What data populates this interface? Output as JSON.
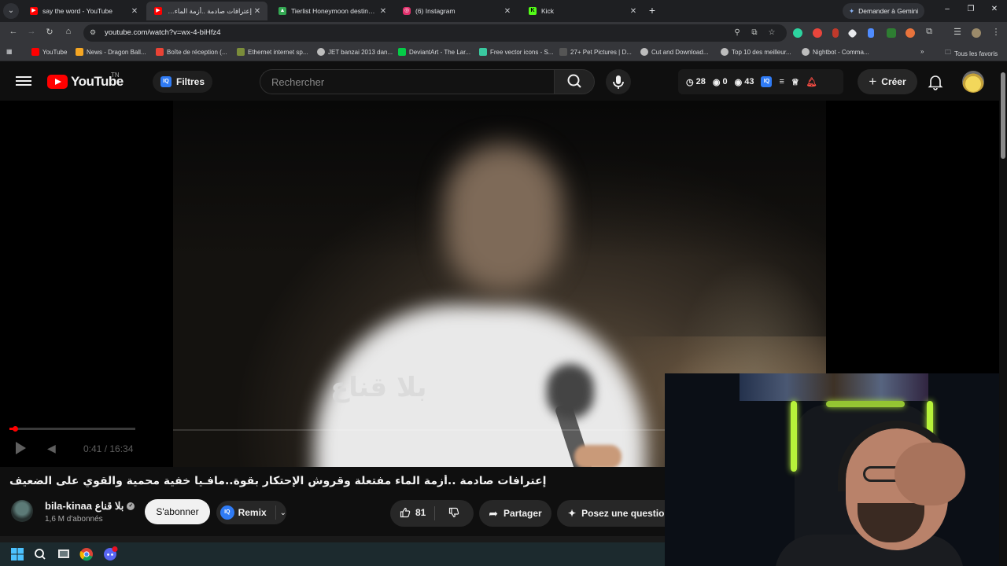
{
  "browser": {
    "tabs": [
      {
        "title": "say the word - YouTube",
        "favicon": "youtube-icon",
        "color": "#ff0000",
        "active": false
      },
      {
        "title": "إعترافات صادمة ..أزمة الماء مفت",
        "favicon": "youtube-icon",
        "color": "#ff0000",
        "active": true
      },
      {
        "title": "Tierlist Honeymoon destination",
        "favicon": "drive-icon",
        "color": "#34a853",
        "active": false
      },
      {
        "title": "(6) Instagram",
        "favicon": "instagram-icon",
        "color": "#e1306c",
        "active": false
      },
      {
        "title": "Kick",
        "favicon": "kick-icon",
        "color": "#53fc18",
        "active": false
      }
    ],
    "gemini_label": "Demander à Gemini",
    "url": "youtube.com/watch?v=wx-4-biHfz4",
    "bookmarks": [
      {
        "label": "YouTube",
        "color": "#ff0000"
      },
      {
        "label": "News - Dragon Ball...",
        "color": "#f5a623"
      },
      {
        "label": "Boîte de réception (...",
        "color": "#ea4335"
      },
      {
        "label": "Ethernet internet sp...",
        "color": "#7b8d3a"
      },
      {
        "label": "JET banzai 2013 dan...",
        "color": "#bdbdbd"
      },
      {
        "label": "DeviantArt - The Lar...",
        "color": "#05cc47"
      },
      {
        "label": "Free vector icons - S...",
        "color": "#3ac9a0"
      },
      {
        "label": "27+ Pet Pictures | D...",
        "color": "#555555"
      },
      {
        "label": "Cut and Download...",
        "color": "#bdbdbd"
      },
      {
        "label": "Top 10 des meilleur...",
        "color": "#bdbdbd"
      },
      {
        "label": "Nightbot - Comma...",
        "color": "#bdbdbd"
      }
    ],
    "all_bookmarks_label": "Tous les favoris"
  },
  "youtube": {
    "logo_text": "YouTube",
    "region": "TN",
    "filters_label": "Filtres",
    "filters_badge": "IQ",
    "search_placeholder": "Rechercher",
    "stats": {
      "time": "28",
      "views_a": "0",
      "views_b": "43"
    },
    "create_label": "Créer"
  },
  "player": {
    "watermark": "بلا قناع",
    "time_display": "0:41 / 16:34",
    "progress_fraction": 0.041
  },
  "video": {
    "title": "إعترافات صادمة ..أزمة الماء مفتعلة وقروش الإحتكار بقوة..مافـيا خفية محمية والقوي على الضعيف",
    "channel_name": "bila-kinaa بلا قناع",
    "subscribers": "1,6 M d'abonnés",
    "subscribe_label": "S'abonner",
    "remix_label": "Remix",
    "likes": "81",
    "share_label": "Partager",
    "ask_label": "Posez une question"
  },
  "colors": {
    "accent": "#ff0000",
    "iq_badge": "#2f7bf5",
    "webcam_led": "#b7f23a"
  }
}
